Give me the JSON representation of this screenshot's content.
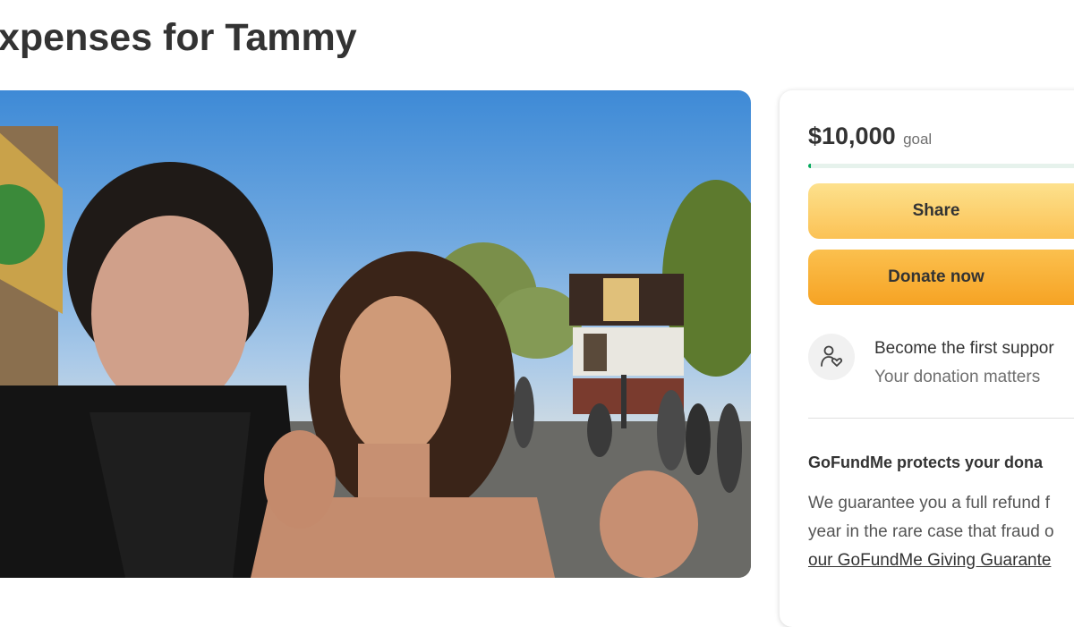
{
  "campaign": {
    "title": "xpenses for Tammy"
  },
  "donation_card": {
    "goal_amount": "$10,000",
    "goal_label": "goal",
    "progress_fraction": 0.01,
    "share_label": "Share",
    "donate_label": "Donate now",
    "supporter_title": "Become the first suppor",
    "supporter_subtitle": "Your donation matters",
    "protect_title": "GoFundMe protects your dona",
    "protect_line1": "We guarantee you a full refund f",
    "protect_line2": "year in the rare case that fraud o",
    "protect_link": "our GoFundMe Giving Guarante"
  },
  "colors": {
    "progress": "#02a95c",
    "share_button": "#fcd06f",
    "donate_button": "#f8b136",
    "text": "#333333"
  }
}
